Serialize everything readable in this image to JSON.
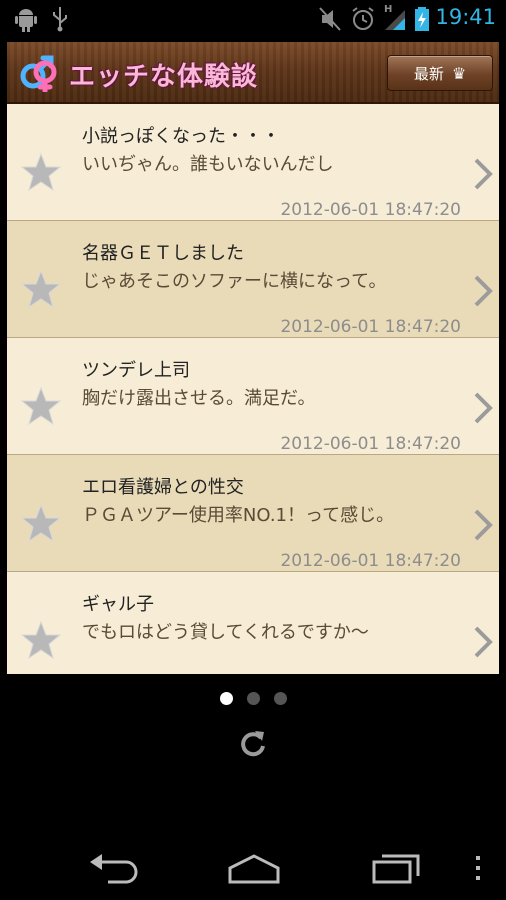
{
  "status_bar": {
    "time": "19:41",
    "icons": [
      "android-debug-icon",
      "usb-icon",
      "mute-icon",
      "alarm-icon",
      "signal-icon",
      "battery-charging-icon"
    ],
    "network_label": "H"
  },
  "header": {
    "app_title": "エッチな体験談",
    "latest_label": "最新",
    "logo_icon": "gender-symbols-logo",
    "latest_icon": "crown-icon"
  },
  "colors": {
    "header_wood": "#5e3519",
    "row_light": "#f7edd6",
    "row_dark": "#e9dbb8",
    "title_pink": "#f9b8d6",
    "time_blue": "#33b5e5"
  },
  "list": {
    "items": [
      {
        "title": "小説っぽくなった・・・",
        "subtitle": "いいぢゃん。誰もいないんだし",
        "date": "2012-06-01 18:47:20"
      },
      {
        "title": "名器ＧＥＴしました",
        "subtitle": "じゃあそこのソファーに横になって。",
        "date": "2012-06-01 18:47:20"
      },
      {
        "title": "ツンデレ上司",
        "subtitle": "胸だけ露出させる。満足だ。",
        "date": "2012-06-01 18:47:20"
      },
      {
        "title": "エロ看護婦との性交",
        "subtitle": "ＰＧＡツアー使用率NO.1！って感じ。",
        "date": "2012-06-01 18:47:20"
      },
      {
        "title": "ギャル子",
        "subtitle": "でもロはどう貸してくれるですか〜",
        "date": ""
      }
    ]
  },
  "pager": {
    "pages": 3,
    "current": 1
  },
  "nav_bar": {
    "icons": [
      "back-icon",
      "home-icon",
      "recent-apps-icon",
      "menu-icon"
    ]
  }
}
